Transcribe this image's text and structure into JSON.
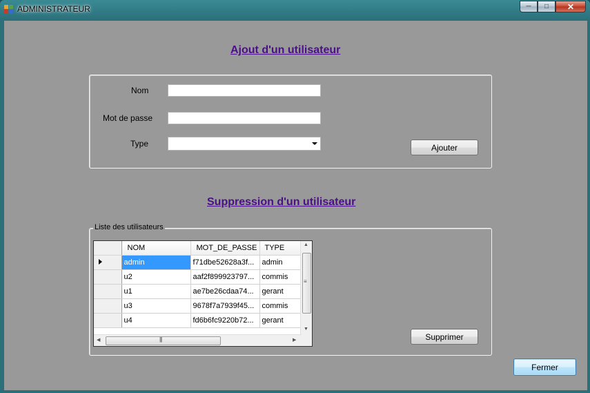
{
  "window": {
    "title": "ADMINISTRATEUR"
  },
  "titlebar_buttons": {
    "minimize_icon": "minimize-icon",
    "maximize_icon": "maximize-icon",
    "close_icon": "close-icon"
  },
  "add_section": {
    "heading": "Ajout d'un utilisateur",
    "nom_label": "Nom",
    "nom_value": "",
    "password_label": "Mot de passe",
    "password_value": "",
    "type_label": "Type",
    "type_value": "",
    "add_button": "Ajouter"
  },
  "delete_section": {
    "heading": "Suppression d'un utilisateur",
    "group_label": "Liste des utilisateurs",
    "columns": [
      "NOM",
      "MOT_DE_PASSE",
      "TYPE"
    ],
    "rows": [
      {
        "nom": "admin",
        "mot_de_passe": "f71dbe52628a3f...",
        "type": "admin"
      },
      {
        "nom": "u2",
        "mot_de_passe": "aaf2f899923797...",
        "type": "commis"
      },
      {
        "nom": "u1",
        "mot_de_passe": "ae7be26cdaa74...",
        "type": "gerant"
      },
      {
        "nom": "u3",
        "mot_de_passe": "9678f7a7939f45...",
        "type": "commis"
      },
      {
        "nom": "u4",
        "mot_de_passe": "fd6b6fc9220b72...",
        "type": "gerant"
      }
    ],
    "delete_button": "Supprimer"
  },
  "close_button": "Fermer",
  "colors": {
    "heading": "#4b0f8a",
    "background": "#999999",
    "selection": "#3399ff"
  }
}
